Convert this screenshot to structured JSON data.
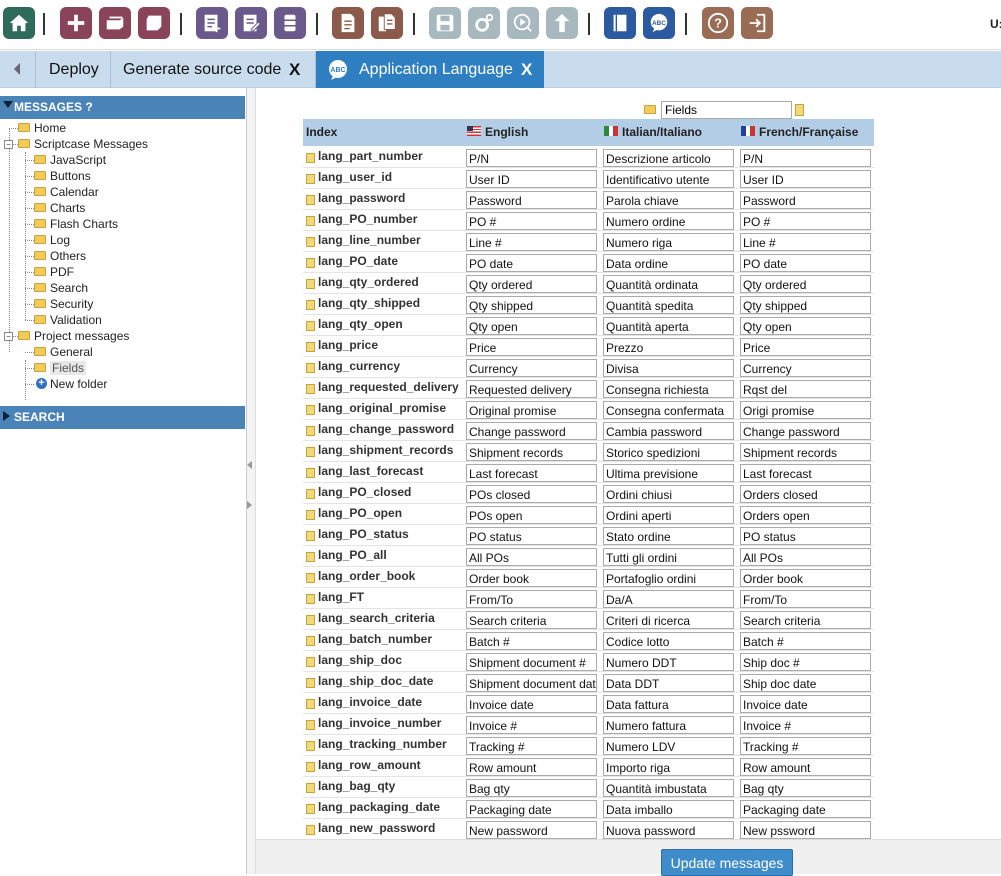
{
  "header": {
    "user_label": "U:"
  },
  "tabs": [
    {
      "label": "Deploy"
    },
    {
      "label": "Generate source code",
      "close": "X"
    },
    {
      "label": "Application Language",
      "close": "X",
      "icon_text": "ABC"
    }
  ],
  "toolbar": {
    "icons": [
      "home-icon",
      "add-icon",
      "open-project-icon",
      "cube-icon",
      "new-app-icon",
      "edit-app-icon",
      "database-icon",
      "document-icon",
      "documents-icon",
      "save-icon",
      "settings-icon",
      "run-icon",
      "deploy-icon",
      "book-icon",
      "language-icon",
      "help-icon",
      "exit-icon"
    ],
    "lang_btn_text": "ABC",
    "help_text": "?"
  },
  "sidebar": {
    "messages_header": "MESSAGES ?",
    "search_header": "SEARCH",
    "tree": {
      "home": "Home",
      "scriptcase": "Scriptcase Messages",
      "scriptcase_children": [
        "JavaScript",
        "Buttons",
        "Calendar",
        "Charts",
        "Flash Charts",
        "Log",
        "Others",
        "PDF",
        "Search",
        "Security",
        "Validation"
      ],
      "project": "Project messages",
      "project_children": [
        "General",
        "Fields",
        "New folder"
      ]
    }
  },
  "filter": {
    "value": "Fields"
  },
  "grid": {
    "columns": {
      "index": "Index",
      "english": "English",
      "italian": "Italian/Italiano",
      "french": "French/Française"
    },
    "rows": [
      {
        "key": "lang_part_number",
        "en": "P/N",
        "it": "Descrizione articolo",
        "fr": "P/N"
      },
      {
        "key": "lang_user_id",
        "en": "User ID",
        "it": "Identificativo utente",
        "fr": "User ID"
      },
      {
        "key": "lang_password",
        "en": "Password",
        "it": "Parola chiave",
        "fr": "Password"
      },
      {
        "key": "lang_PO_number",
        "en": "PO #",
        "it": "Numero ordine",
        "fr": "PO #"
      },
      {
        "key": "lang_line_number",
        "en": "Line #",
        "it": "Numero riga",
        "fr": "Line #"
      },
      {
        "key": "lang_PO_date",
        "en": "PO date",
        "it": "Data ordine",
        "fr": "PO date"
      },
      {
        "key": "lang_qty_ordered",
        "en": "Qty ordered",
        "it": "Quantità ordinata",
        "fr": "Qty ordered"
      },
      {
        "key": "lang_qty_shipped",
        "en": "Qty shipped",
        "it": "Quantità spedita",
        "fr": "Qty shipped"
      },
      {
        "key": "lang_qty_open",
        "en": "Qty open",
        "it": "Quantità aperta",
        "fr": "Qty open"
      },
      {
        "key": "lang_price",
        "en": "Price",
        "it": "Prezzo",
        "fr": "Price"
      },
      {
        "key": "lang_currency",
        "en": "Currency",
        "it": "Divisa",
        "fr": "Currency"
      },
      {
        "key": "lang_requested_delivery",
        "en": "Requested delivery",
        "it": "Consegna richiesta",
        "fr": "Rqst del"
      },
      {
        "key": "lang_original_promise",
        "en": "Original promise",
        "it": "Consegna confermata",
        "fr": "Origi promise"
      },
      {
        "key": "lang_change_password",
        "en": "Change password",
        "it": "Cambia password",
        "fr": "Change password"
      },
      {
        "key": "lang_shipment_records",
        "en": "Shipment records",
        "it": "Storico spedizioni",
        "fr": "Shipment records"
      },
      {
        "key": "lang_last_forecast",
        "en": "Last forecast",
        "it": "Ultima previsione",
        "fr": "Last forecast"
      },
      {
        "key": "lang_PO_closed",
        "en": "POs closed",
        "it": "Ordini chiusi",
        "fr": "Orders closed"
      },
      {
        "key": "lang_PO_open",
        "en": "POs open",
        "it": "Ordini aperti",
        "fr": "Orders open"
      },
      {
        "key": "lang_PO_status",
        "en": "PO status",
        "it": "Stato ordine",
        "fr": "PO status"
      },
      {
        "key": "lang_PO_all",
        "en": "All POs",
        "it": "Tutti gli ordini",
        "fr": "All POs"
      },
      {
        "key": "lang_order_book",
        "en": "Order book",
        "it": "Portafoglio ordini",
        "fr": "Order book"
      },
      {
        "key": "lang_FT",
        "en": "From/To",
        "it": "Da/A",
        "fr": "From/To"
      },
      {
        "key": "lang_search_criteria",
        "en": "Search criteria",
        "it": "Criteri di ricerca",
        "fr": "Search criteria"
      },
      {
        "key": "lang_batch_number",
        "en": "Batch #",
        "it": "Codice lotto",
        "fr": "Batch #"
      },
      {
        "key": "lang_ship_doc",
        "en": "Shipment document #",
        "it": "Numero DDT",
        "fr": "Ship doc #"
      },
      {
        "key": "lang_ship_doc_date",
        "en": "Shipment document date",
        "it": "Data DDT",
        "fr": "Ship doc date"
      },
      {
        "key": "lang_invoice_date",
        "en": "Invoice date",
        "it": "Data fattura",
        "fr": "Invoice date"
      },
      {
        "key": "lang_invoice_number",
        "en": "Invoice #",
        "it": "Numero fattura",
        "fr": "Invoice #"
      },
      {
        "key": "lang_tracking_number",
        "en": "Tracking #",
        "it": "Numero LDV",
        "fr": "Tracking #"
      },
      {
        "key": "lang_row_amount",
        "en": "Row amount",
        "it": "Importo riga",
        "fr": "Row amount"
      },
      {
        "key": "lang_bag_qty",
        "en": "Bag qty",
        "it": "Quantità imbustata",
        "fr": "Bag qty"
      },
      {
        "key": "lang_packaging_date",
        "en": "Packaging date",
        "it": "Data imballo",
        "fr": "Packaging date"
      },
      {
        "key": "lang_new_password",
        "en": "New password",
        "it": "Nuova password",
        "fr": "New pssword"
      }
    ]
  },
  "footer": {
    "update_label": "Update messages"
  },
  "colors": {
    "toolbar_home": "#2f6b5a",
    "toolbar_maroon": "#8a4459",
    "toolbar_purple": "#6a5a8c",
    "toolbar_doc": "#8b5a4a",
    "toolbar_disabled": "#a8b8bf",
    "toolbar_blue": "#2c5aa0",
    "toolbar_brown": "#9a6b55",
    "tab_active": "#2d7fc2",
    "tab_bar": "#c9dced",
    "sidebar_header": "#4a83b7",
    "grid_header": "#b4cde6",
    "button": "#3f8ccb"
  }
}
